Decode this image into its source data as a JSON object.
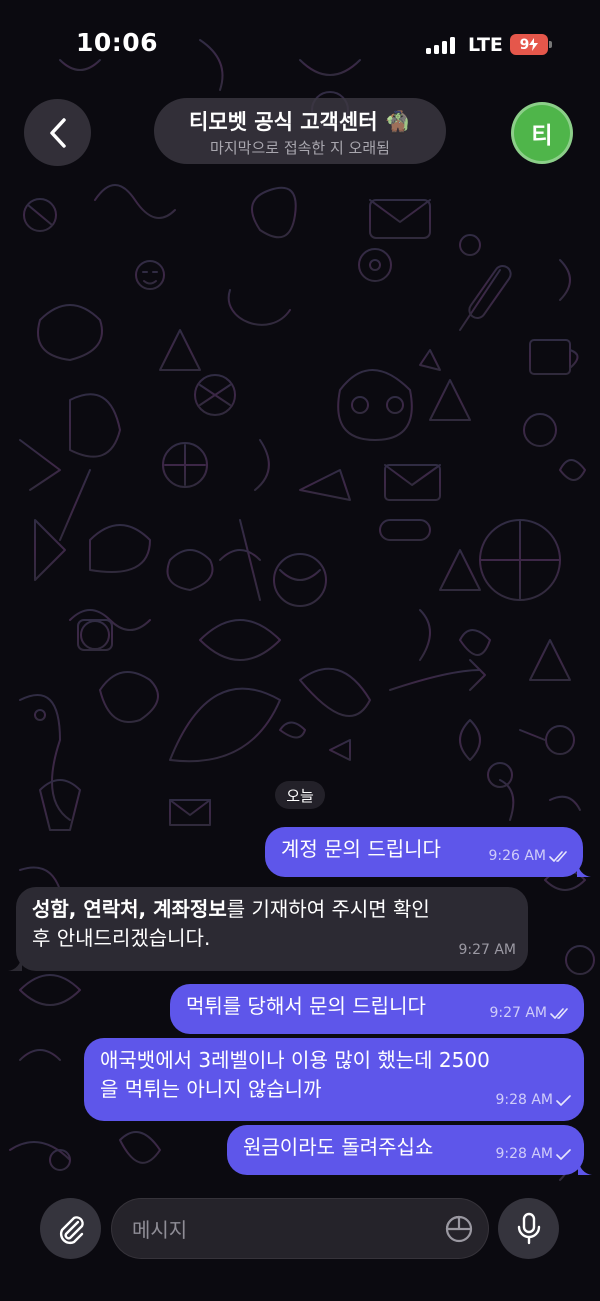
{
  "status_bar": {
    "time": "10:06",
    "network": "LTE",
    "battery": "9"
  },
  "header": {
    "title": "티모벳 공식 고객센터 🧌",
    "subtitle": "마지막으로 접속한 지 오래됨",
    "avatar_letter": "티"
  },
  "chat": {
    "date_label": "오늘",
    "messages": [
      {
        "direction": "out",
        "lines": [
          "계정 문의 드립니다"
        ],
        "time": "9:26 AM",
        "read": true
      },
      {
        "direction": "in",
        "lines": [
          "",
          "후 안내드리겠습니다."
        ],
        "segments": [
          {
            "text": "성함, 연락처, 계좌정보",
            "bold": true
          },
          {
            "text": "를 기재하여 주시면 확인",
            "bold": false
          }
        ],
        "time": "9:27 AM"
      },
      {
        "direction": "out",
        "lines": [
          "먹튀를 당해서 문의 드립니다"
        ],
        "time": "9:27 AM",
        "read": true
      },
      {
        "direction": "out",
        "lines": [
          "애국뱃에서 3레벨이나 이용 많이 했는데 2500",
          "을 먹튀는 아니지 않습니까"
        ],
        "time": "9:28 AM",
        "read": false
      },
      {
        "direction": "out",
        "lines": [
          "원금이라도 돌려주십쇼"
        ],
        "time": "9:28 AM",
        "read": false
      }
    ]
  },
  "composer": {
    "placeholder": "메시지"
  },
  "colors": {
    "outgoing_bubble": "#5e56ea",
    "incoming_bubble": "#2c2a33",
    "avatar": "#4fb54a",
    "battery": "#e5574b"
  },
  "icons": [
    "chevron-left-icon",
    "paperclip-icon",
    "sticker-icon",
    "microphone-icon",
    "double-check-icon",
    "single-check-icon"
  ]
}
